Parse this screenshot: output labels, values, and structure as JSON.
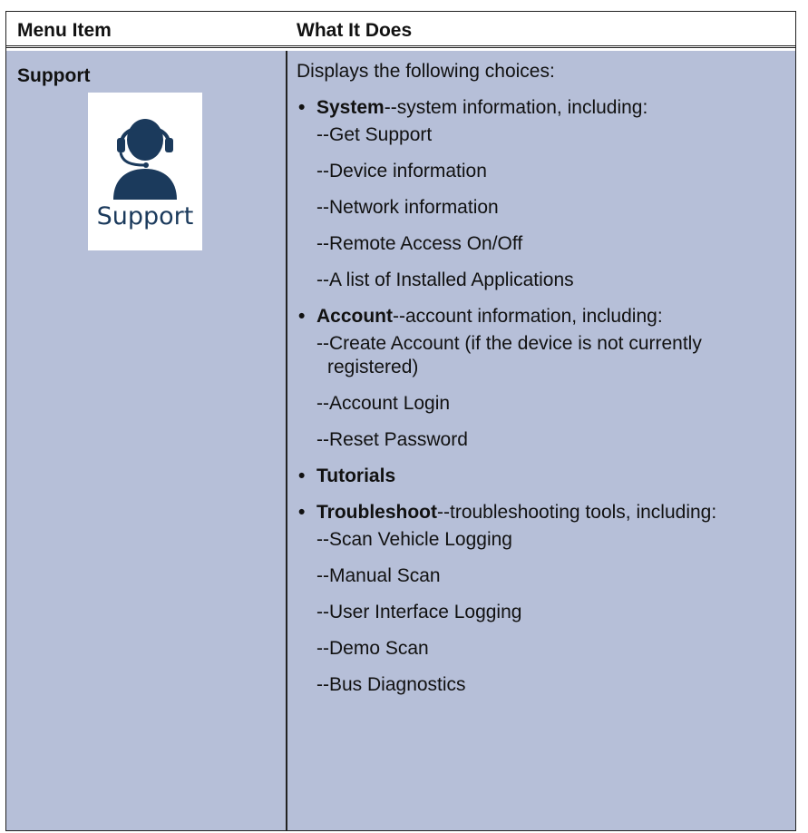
{
  "header": {
    "col1": "Menu Item",
    "col2": "What It Does"
  },
  "row": {
    "item_name": "Support",
    "icon": {
      "name": "headset-person-icon",
      "label": "Support",
      "color": "#1b3a5c"
    },
    "intro": "Displays the following choices:",
    "sections": [
      {
        "title": "System",
        "desc": "--system information, including:",
        "items": [
          "--Get Support",
          "--Device information",
          "--Network information",
          "--Remote Access On/Off",
          "--A list of Installed Applications"
        ]
      },
      {
        "title": "Account",
        "desc": "--account information, including:",
        "items": [
          "--Create Account (if the device is not currently registered)",
          "--Account Login",
          "--Reset Password"
        ]
      },
      {
        "title": "Tutorials",
        "desc": "",
        "items": []
      },
      {
        "title": "Troubleshoot",
        "desc": "--troubleshooting tools, including:",
        "items": [
          "--Scan Vehicle Logging",
          "--Manual Scan",
          "--User Interface Logging",
          "--Demo Scan",
          "--Bus Diagnostics"
        ]
      }
    ]
  },
  "colors": {
    "cell_background": "#b6bfd8",
    "border": "#222222"
  }
}
